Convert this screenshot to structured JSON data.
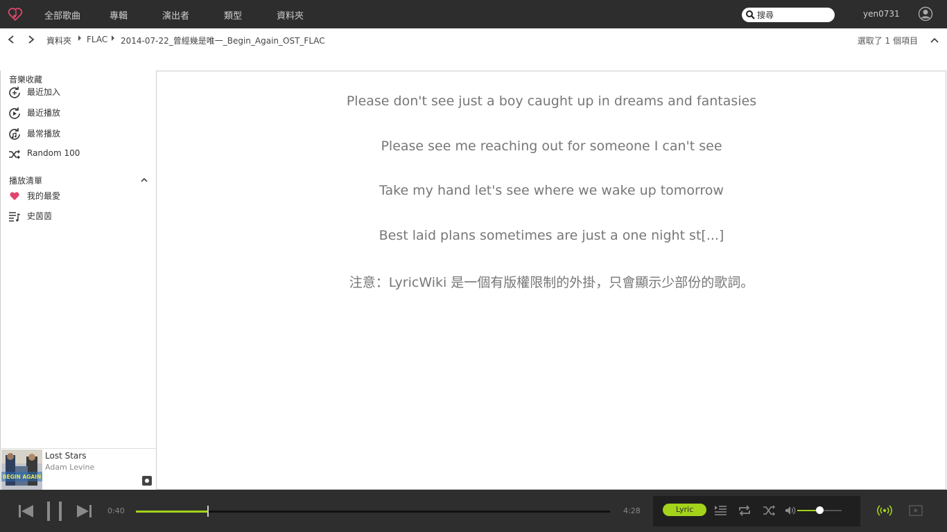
{
  "nav": {
    "items": [
      "全部歌曲",
      "專輯",
      "演出者",
      "類型",
      "資料夾"
    ]
  },
  "search": {
    "value": "搜尋"
  },
  "user": {
    "name": "yen0731"
  },
  "breadcrumb": {
    "items": [
      "資料夾",
      "FLAC",
      "2014-07-22_曾經幾是唯一_Begin_Again_OST_FLAC"
    ],
    "selected_info": "選取了 1 個項目"
  },
  "sidebar": {
    "library_title": "音樂收藏",
    "library_items": [
      {
        "label": "最近加入",
        "icon": "recently-added-icon"
      },
      {
        "label": "最近播放",
        "icon": "recently-played-icon"
      },
      {
        "label": "最常播放",
        "icon": "most-played-icon"
      },
      {
        "label": "Random 100",
        "icon": "shuffle-icon"
      }
    ],
    "playlist_title": "播放清單",
    "playlist_items": [
      {
        "label": "我的最愛",
        "icon": "heart-icon"
      },
      {
        "label": "史茵茵",
        "icon": "playlist-icon"
      }
    ]
  },
  "now_playing": {
    "title": "Lost Stars",
    "artist": "Adam Levine",
    "cover_text": "BEGIN AGAIN"
  },
  "lyrics": {
    "lines": [
      "Please don't see just a boy caught up in dreams and fantasies",
      "Please see me reaching out for someone I can't see",
      "Take my hand let's see where we wake up tomorrow",
      "Best laid plans sometimes are just a one night st[...]",
      "注意：LyricWiki 是一個有版權限制的外掛，只會顯示少部份的歌詞。"
    ]
  },
  "player": {
    "current_time": "0:40",
    "total_time": "4:28",
    "progress": 0.15,
    "volume": 0.5,
    "lyric_button": "Lyric"
  },
  "colors": {
    "accent": "#a3d31a",
    "bar_bg": "#2d2d2d",
    "logo": "#e0466a"
  }
}
